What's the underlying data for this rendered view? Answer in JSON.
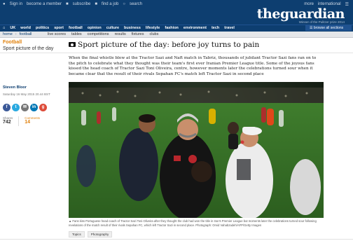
{
  "header": {
    "top_links": [
      "Sign in",
      "become a member",
      "",
      "subscribe",
      "",
      "find a job",
      "",
      "search"
    ],
    "top_right": [
      "more",
      "international",
      ""
    ],
    "logo": "theguardian",
    "logo_sub": "Winner of the Pulitzer prize 2014",
    "nav": [
      "UK",
      "world",
      "politics",
      "sport",
      "football",
      "opinion",
      "culture",
      "business",
      "lifestyle",
      "fashion",
      "environment",
      "tech",
      "travel"
    ],
    "browse_all": "browse all sections"
  },
  "subnav": {
    "breadcrumb": [
      "home",
      "football"
    ],
    "items": [
      "live scores",
      "tables",
      "competitions",
      "results",
      "fixtures",
      "clubs"
    ]
  },
  "article": {
    "section": "Football",
    "series": "Sport picture of the day",
    "headline": "Sport picture of the day: before joy turns to pain",
    "standfirst": "When the final whistle blew at the Tractor Sazi and Naft match in Tabriz, thousands of jubilant Tractor Sazi fans ran on to the pitch to celebrate what they thought was their team's first ever Iranian Premier League title. Some of the joyous fans kissed the head coach of Tractor Sazi Toni Oliveira, centre, however moments later the celebrations turned sour when it became clear that the result of their rivals Sepahan FC's match left Tractor Sazi in second place",
    "author": "Steven Bloor",
    "dateline": "Saturday 16 May 2015 20.44 BST",
    "shares_label": "Shares",
    "shares": "742",
    "comments_label": "Comments",
    "comments": "14",
    "caption": "Fans kiss Portuguese head coach of Tractor Sazi Toni Oliveira after they thought the club had won the title in Iran's Premier League but moments later the celebrations turned sour following revelations of the match result of their rivals Sepahan FC, which left Tractor Sazi in second place. Photograph: Omid Vahabzadeh/AFP/Getty Images",
    "tags": [
      "Topics",
      "Photography"
    ]
  },
  "colors": {
    "masthead": "#0d3e70",
    "section_accent": "#e0800b"
  }
}
